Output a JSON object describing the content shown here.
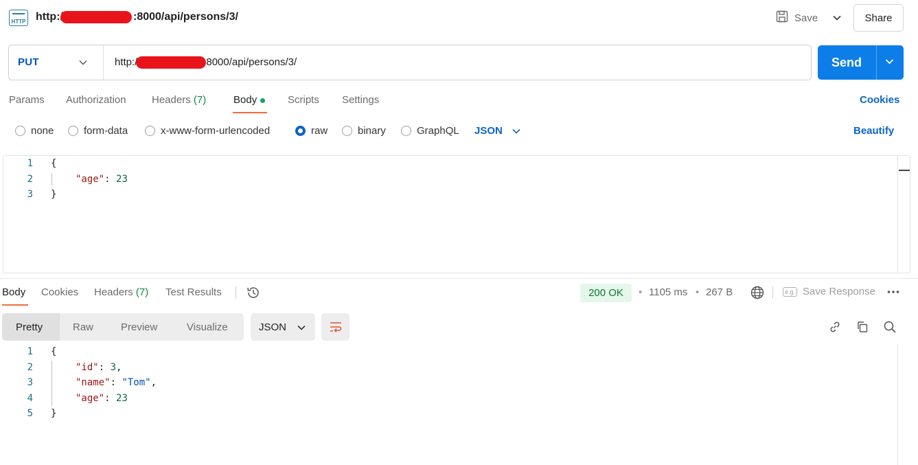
{
  "header": {
    "url_prefix": "http:/",
    "url_suffix": ":8000/api/persons/3/",
    "save_label": "Save",
    "share_label": "Share"
  },
  "request": {
    "method": "PUT",
    "url_prefix": "http:/",
    "url_suffix": "8000/api/persons/3/",
    "send_label": "Send"
  },
  "tabs": {
    "params": "Params",
    "authorization": "Authorization",
    "headers": "Headers",
    "headers_count": "(7)",
    "body": "Body",
    "scripts": "Scripts",
    "settings": "Settings",
    "cookies": "Cookies"
  },
  "body_types": {
    "none": "none",
    "form_data": "form-data",
    "urlencoded": "x-www-form-urlencoded",
    "raw": "raw",
    "binary": "binary",
    "graphql": "GraphQL",
    "format": "JSON",
    "beautify": "Beautify",
    "selected": "raw"
  },
  "request_body": {
    "lines": [
      "1",
      "2",
      "3"
    ],
    "open": "{",
    "key": "\"age\"",
    "value": "23",
    "close": "}"
  },
  "response": {
    "tabs": {
      "body": "Body",
      "cookies": "Cookies",
      "headers": "Headers",
      "headers_count": "(7)",
      "test_results": "Test Results"
    },
    "status": "200 OK",
    "time": "1105 ms",
    "size": "267 B",
    "save_response": "Save Response",
    "eg_badge": "e.g.",
    "views": {
      "pretty": "Pretty",
      "raw": "Raw",
      "preview": "Preview",
      "visualize": "Visualize"
    },
    "format": "JSON",
    "body": {
      "lines": [
        "1",
        "2",
        "3",
        "4",
        "5"
      ],
      "open": "{",
      "id_key": "\"id\"",
      "id_value": "3",
      "name_key": "\"name\"",
      "name_value": "\"Tom\"",
      "age_key": "\"age\"",
      "age_value": "23",
      "close": "}"
    }
  },
  "colors": {
    "accent": "#0d7ee8",
    "tab_underline": "#f26b3a",
    "status_ok": "#0b7a33",
    "redaction": "#e8141c"
  }
}
